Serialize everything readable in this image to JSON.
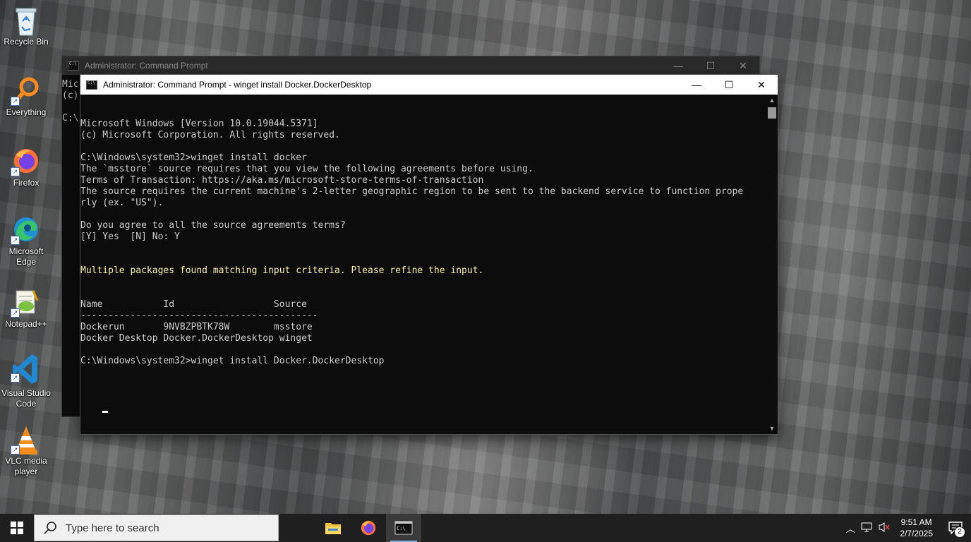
{
  "desktop_icons": [
    {
      "label": "Recycle Bin",
      "icon": "recycle-bin-icon"
    },
    {
      "label": "Everything",
      "icon": "everything-search-icon"
    },
    {
      "label": "Firefox",
      "icon": "firefox-icon"
    },
    {
      "label": "Microsoft Edge",
      "icon": "edge-icon"
    },
    {
      "label": "Notepad++",
      "icon": "notepad-plus-plus-icon"
    },
    {
      "label": "Visual Studio Code",
      "icon": "vscode-icon"
    },
    {
      "label": "VLC media player",
      "icon": "vlc-icon"
    }
  ],
  "bg_window": {
    "title": "Administrator: Command Prompt",
    "visible_text": "Mic\n(c)\n\nC:\\"
  },
  "fg_window": {
    "title": "Administrator: Command Prompt - winget  install Docker.DockerDesktop",
    "console_lines": [
      "Microsoft Windows [Version 10.0.19044.5371]",
      "(c) Microsoft Corporation. All rights reserved.",
      "",
      "C:\\Windows\\system32>winget install docker",
      "The `msstore` source requires that you view the following agreements before using.",
      "Terms of Transaction: https://aka.ms/microsoft-store-terms-of-transaction",
      "The source requires the current machine's 2-letter geographic region to be sent to the backend service to function prope",
      "rly (ex. \"US\").",
      "",
      "Do you agree to all the source agreements terms?",
      "[Y] Yes  [N] No: Y"
    ],
    "warning_line": "Multiple packages found matching input criteria. Please refine the input.",
    "table_lines": [
      "Name           Id                  Source",
      "-------------------------------------------",
      "Dockerun       9NVBZPBTK78W        msstore",
      "Docker Desktop Docker.DockerDesktop winget",
      "",
      "C:\\Windows\\system32>winget install Docker.DockerDesktop"
    ]
  },
  "taskbar": {
    "search_placeholder": "Type here to search",
    "apps": [
      "file-explorer-icon",
      "firefox-icon",
      "command-prompt-icon"
    ],
    "time": "9:51 AM",
    "date": "2/7/2025",
    "notification_count": "2"
  },
  "colors": {
    "console_bg": "#0c0c0c",
    "console_text": "#cccccc",
    "warning_text": "#f9f1a5",
    "taskbar_bg": "#1f1f1f"
  }
}
